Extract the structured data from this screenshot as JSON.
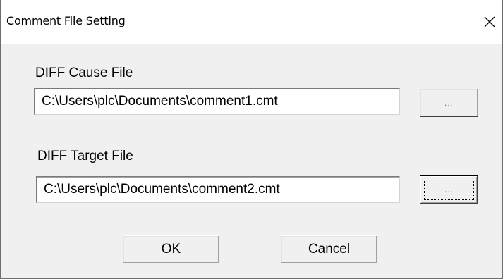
{
  "window": {
    "title": "Comment File Setting",
    "close_glyph": "close-icon"
  },
  "cause": {
    "label": "DIFF Cause File",
    "path": "C:\\Users\\plc\\Documents\\comment1.cmt",
    "browse_label": "..."
  },
  "target": {
    "label": "DIFF Target File",
    "path": "C:\\Users\\plc\\Documents\\comment2.cmt",
    "browse_label": "..."
  },
  "buttons": {
    "ok_mnemonic": "O",
    "ok_rest": "K",
    "cancel_label": "Cancel"
  }
}
